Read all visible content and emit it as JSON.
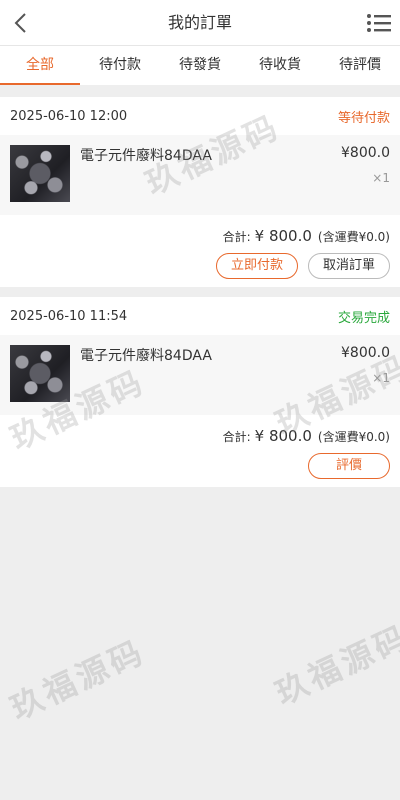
{
  "header": {
    "title": "我的訂單"
  },
  "tabs": [
    {
      "label": "全部",
      "active": true
    },
    {
      "label": "待付款",
      "active": false
    },
    {
      "label": "待發貨",
      "active": false
    },
    {
      "label": "待收貨",
      "active": false
    },
    {
      "label": "待評價",
      "active": false
    }
  ],
  "orders": [
    {
      "time": "2025-06-10 12:00",
      "status": "等待付款",
      "status_color": "#e8692d",
      "product": {
        "name": "電子元件廢料84DAA",
        "price": "¥800.0",
        "qty": "×1"
      },
      "total_label": "合計:",
      "total_amount": "¥ 800.0",
      "shipping_note": "(含運費¥0.0)",
      "buttons": [
        "立即付款",
        "取消訂單"
      ]
    },
    {
      "time": "2025-06-10 11:54",
      "status": "交易完成",
      "status_color": "#2aa83c",
      "product": {
        "name": "電子元件廢料84DAA",
        "price": "¥800.0",
        "qty": "×1"
      },
      "total_label": "合計:",
      "total_amount": "¥ 800.0",
      "shipping_note": "(含運費¥0.0)",
      "buttons": [
        "評價"
      ]
    }
  ],
  "watermark_text": "玖福源码",
  "colors": {
    "accent": "#e8692d",
    "success": "#2aa83c"
  }
}
